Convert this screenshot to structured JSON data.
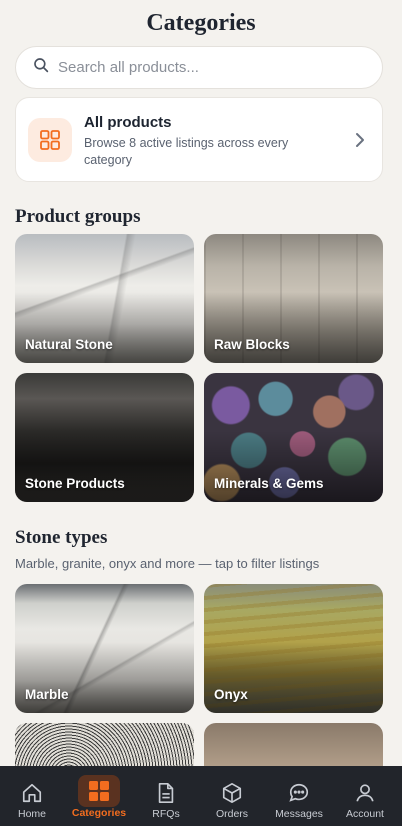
{
  "header": {
    "title": "Categories"
  },
  "search": {
    "placeholder": "Search all products..."
  },
  "all_products": {
    "title": "All products",
    "subtitle": "Browse 8 active listings across every category"
  },
  "product_groups": {
    "title": "Product groups",
    "items": [
      {
        "label": "Natural Stone"
      },
      {
        "label": "Raw Blocks"
      },
      {
        "label": "Stone Products"
      },
      {
        "label": "Minerals & Gems"
      }
    ]
  },
  "stone_types": {
    "title": "Stone types",
    "subtitle": "Marble, granite, onyx and more — tap to filter listings",
    "items": [
      {
        "label": "Marble"
      },
      {
        "label": "Onyx"
      },
      {
        "label": ""
      },
      {
        "label": ""
      }
    ]
  },
  "bottom_nav": {
    "items": [
      {
        "label": "Home",
        "icon": "home-icon"
      },
      {
        "label": "Categories",
        "icon": "grid-icon",
        "active": true
      },
      {
        "label": "RFQs",
        "icon": "document-icon"
      },
      {
        "label": "Orders",
        "icon": "box-icon"
      },
      {
        "label": "Messages",
        "icon": "chat-icon"
      },
      {
        "label": "Account",
        "icon": "user-icon"
      }
    ]
  },
  "colors": {
    "accent": "#f26d1f",
    "background": "#f4f2ee",
    "nav_background": "#22252b"
  }
}
